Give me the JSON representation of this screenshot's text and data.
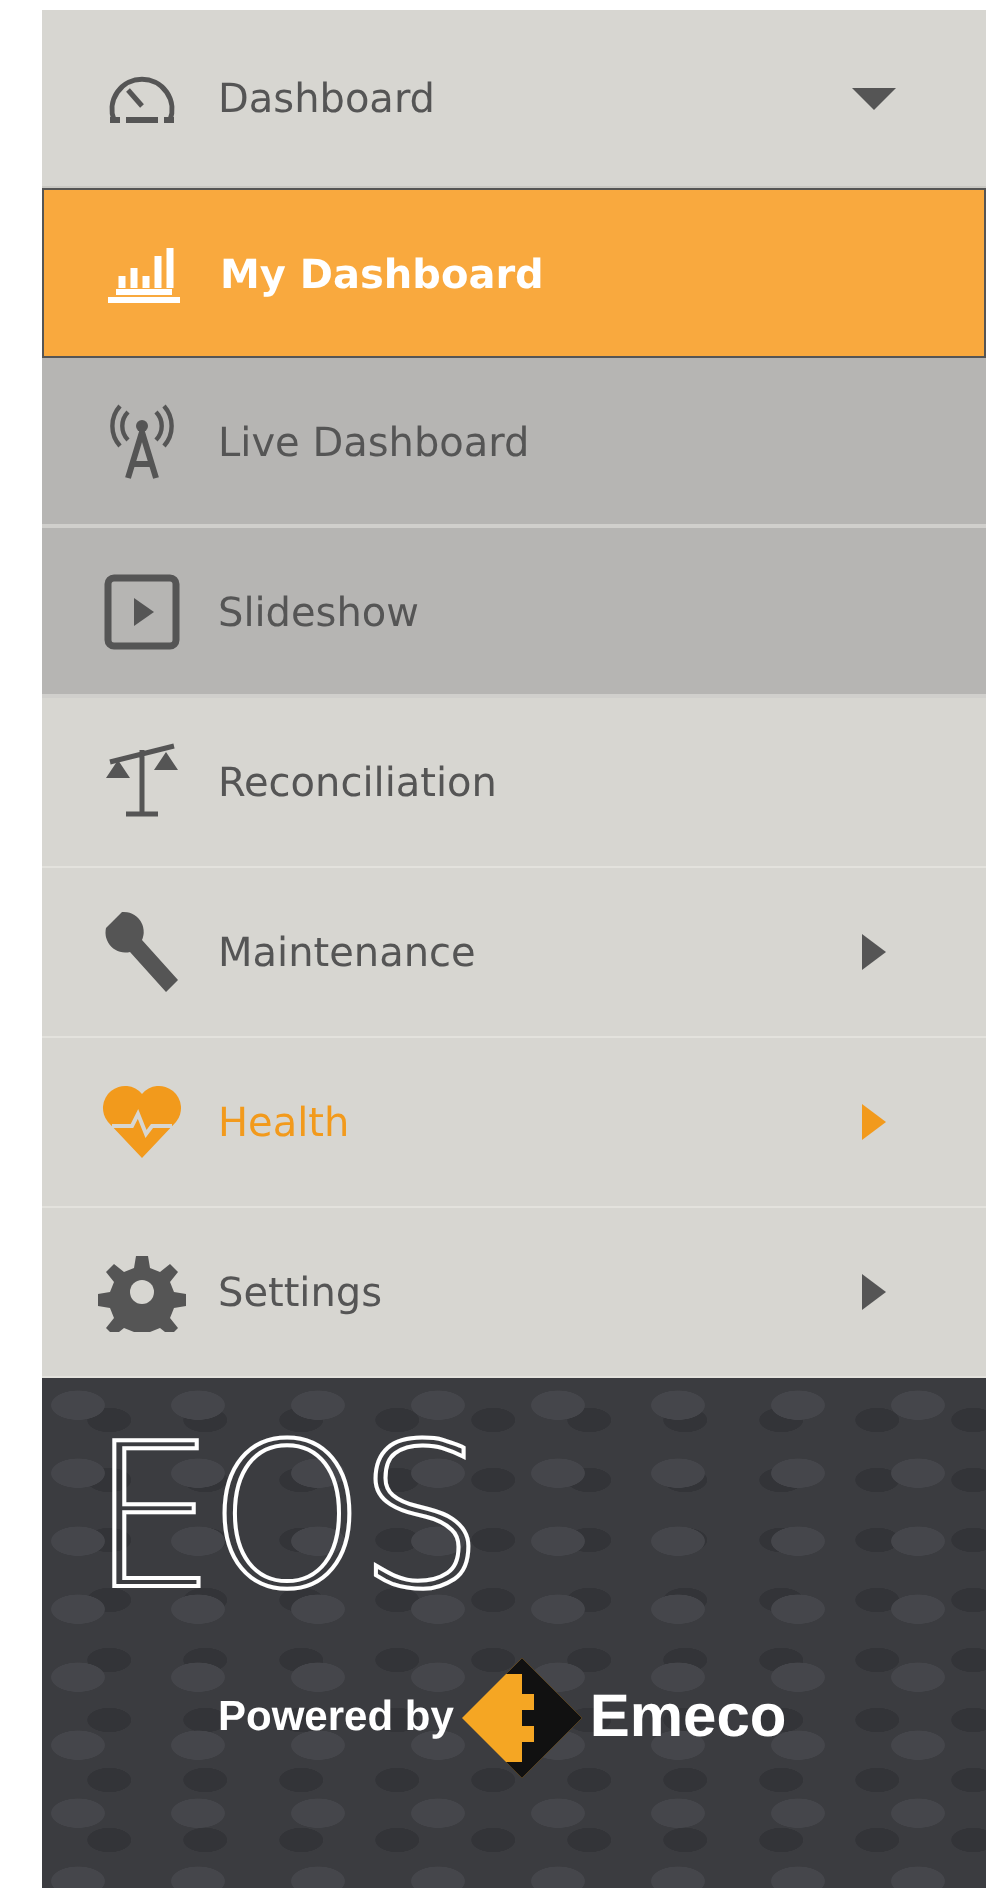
{
  "menu": {
    "header": {
      "label": "Dashboard",
      "expanded": true
    },
    "sub_items": [
      {
        "label": "My Dashboard",
        "selected": true
      },
      {
        "label": "Live Dashboard",
        "selected": false
      },
      {
        "label": "Slideshow",
        "selected": false
      }
    ],
    "items": [
      {
        "label": "Reconciliation",
        "highlighted": false,
        "has_submenu": false
      },
      {
        "label": "Maintenance",
        "highlighted": false,
        "has_submenu": true
      },
      {
        "label": "Health",
        "highlighted": true,
        "has_submenu": true
      },
      {
        "label": "Settings",
        "highlighted": false,
        "has_submenu": true
      }
    ]
  },
  "footer": {
    "logo": "EOS",
    "powered_by": "Powered by",
    "brand": "Emeco"
  }
}
